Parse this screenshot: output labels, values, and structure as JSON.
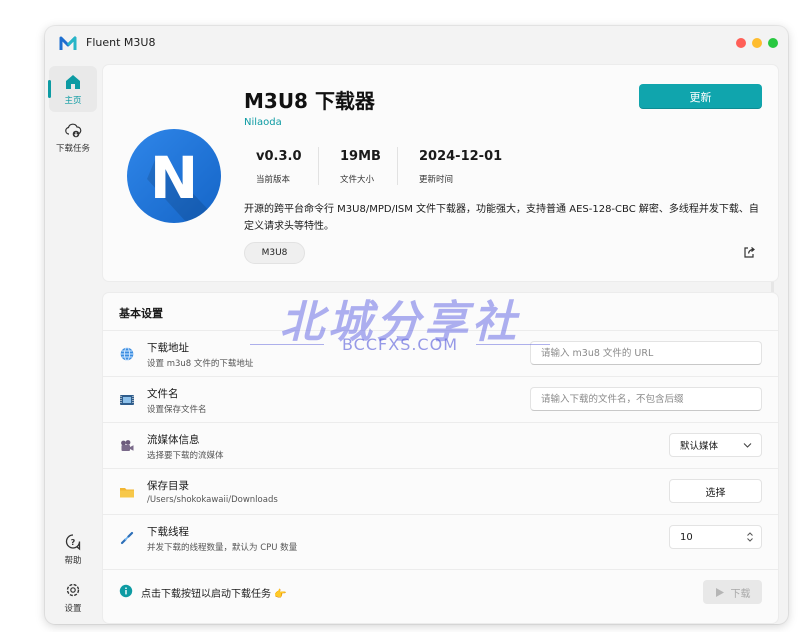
{
  "window": {
    "title": "Fluent M3U8"
  },
  "sidebar": {
    "home_label": "主页",
    "tasks_label": "下载任务",
    "help_label": "帮助",
    "settings_label": "设置"
  },
  "app": {
    "name": "M3U8 下载器",
    "author": "Nilaoda",
    "update_label": "更新",
    "logo_letter": "N",
    "stats": [
      {
        "value": "v0.3.0",
        "label": "当前版本"
      },
      {
        "value": "19MB",
        "label": "文件大小"
      },
      {
        "value": "2024-12-01",
        "label": "更新时间"
      }
    ],
    "description": "开源的跨平台命令行 M3U8/MPD/ISM 文件下载器，功能强大，支持普通 AES-128-CBC 解密、多线程并发下载、自定义请求头等特性。",
    "tag": "M3U8"
  },
  "settings": {
    "section_title": "基本设置",
    "rows": [
      {
        "title": "下载地址",
        "subtitle": "设置 m3u8 文件的下载地址",
        "placeholder": "请输入 m3u8 文件的 URL"
      },
      {
        "title": "文件名",
        "subtitle": "设置保存文件名",
        "placeholder": "请输入下载的文件名，不包含后缀"
      },
      {
        "title": "流媒体信息",
        "subtitle": "选择要下载的流媒体",
        "value": "默认媒体"
      },
      {
        "title": "保存目录",
        "subtitle": "/Users/shokokawaii/Downloads",
        "button": "选择"
      },
      {
        "title": "下载线程",
        "subtitle": "并发下载的线程数量，默认为 CPU 数量",
        "value": "10"
      }
    ],
    "footer_text": "点击下载按钮以启动下载任务 👉",
    "download_label": "下载"
  },
  "watermark": {
    "cn": "北城分享社",
    "en": "BCCFXS.COM"
  },
  "colors": {
    "accent": "#10a5ad",
    "logo_blue": "#1f78dc"
  }
}
